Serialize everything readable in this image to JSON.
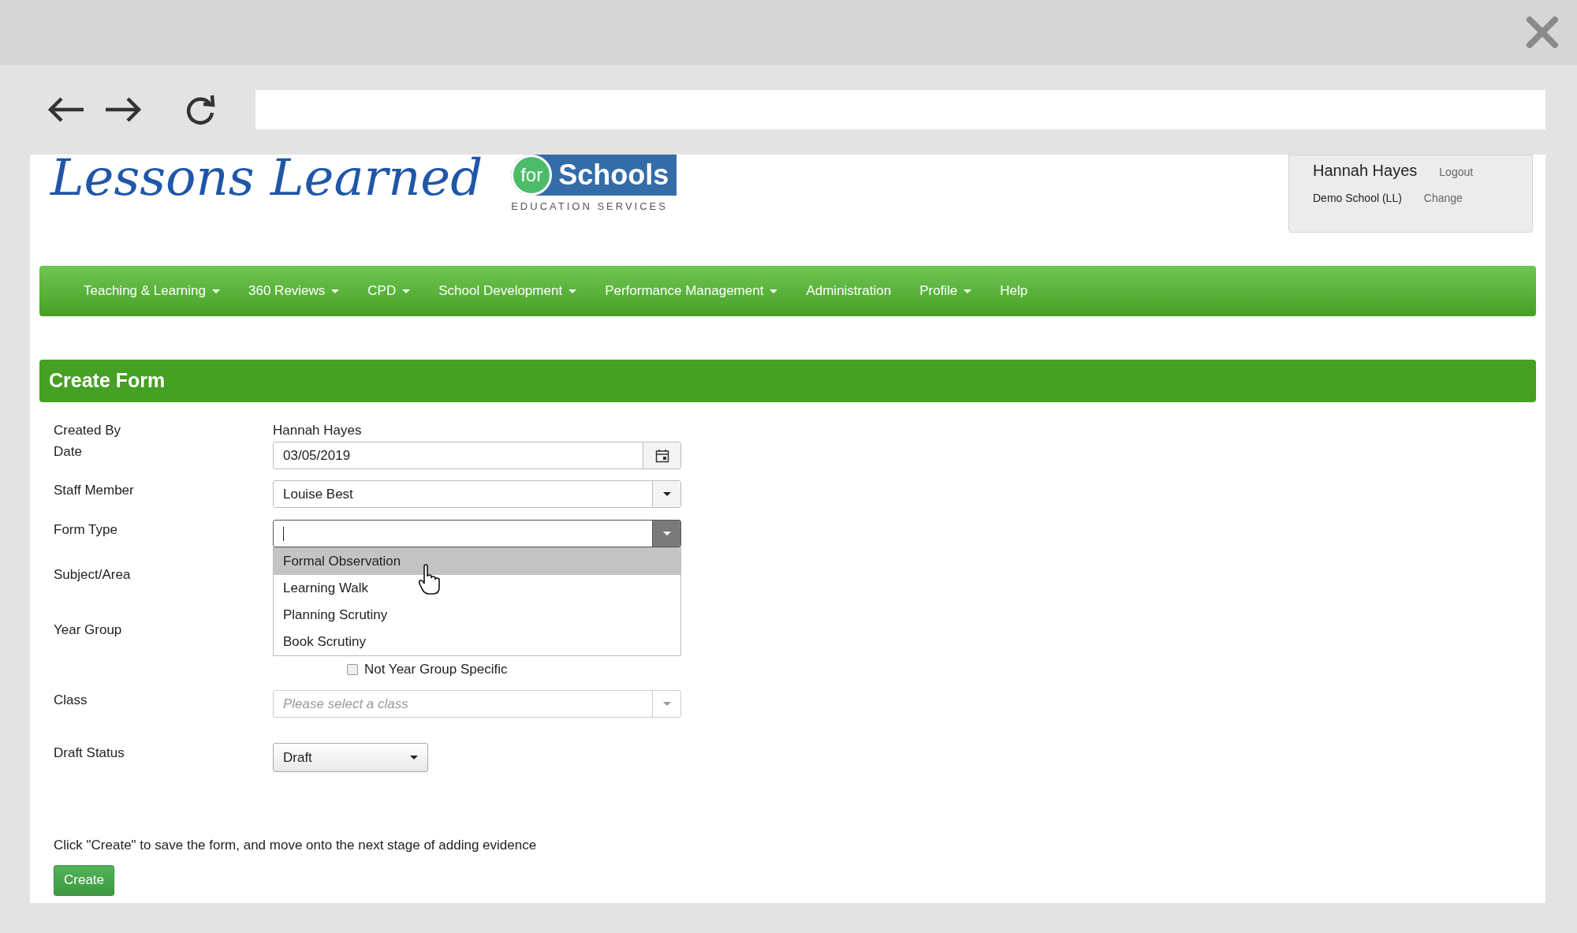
{
  "logo": {
    "title": "Lessons Learned",
    "badge_small": "for",
    "badge_large": "Schools",
    "tagline": "EDUCATION SERVICES"
  },
  "user_panel": {
    "name": "Hannah Hayes",
    "logout": "Logout",
    "school": "Demo School (LL)",
    "change": "Change"
  },
  "nav": [
    {
      "label": "Teaching & Learning",
      "caret": true
    },
    {
      "label": "360 Reviews",
      "caret": true
    },
    {
      "label": "CPD",
      "caret": true
    },
    {
      "label": "School Development",
      "caret": true
    },
    {
      "label": "Performance Management",
      "caret": true
    },
    {
      "label": "Administration",
      "caret": false
    },
    {
      "label": "Profile",
      "caret": true
    },
    {
      "label": "Help",
      "caret": false
    }
  ],
  "panel": {
    "title": "Create Form"
  },
  "form": {
    "created_by": {
      "label": "Created By",
      "value": "Hannah Hayes"
    },
    "date": {
      "label": "Date",
      "value": "03/05/2019"
    },
    "staff_member": {
      "label": "Staff Member",
      "value": "Louise Best"
    },
    "form_type": {
      "label": "Form Type",
      "expanded": true,
      "options": [
        {
          "label": "Formal Observation",
          "selected": true
        },
        {
          "label": "Learning Walk",
          "selected": false
        },
        {
          "label": "Planning Scrutiny",
          "selected": false
        },
        {
          "label": "Book Scrutiny",
          "selected": false
        }
      ]
    },
    "subject_area": {
      "label": "Subject/Area"
    },
    "year_group": {
      "label": "Year Group",
      "checkbox": {
        "label": "Not Year Group Specific",
        "checked": false
      }
    },
    "class": {
      "label": "Class",
      "placeholder": "Please select a class"
    },
    "draft_status": {
      "label": "Draft Status",
      "value": "Draft"
    }
  },
  "instruction": "Click \"Create\" to save the form, and move onto the next stage of adding evidence",
  "create_button": "Create"
}
